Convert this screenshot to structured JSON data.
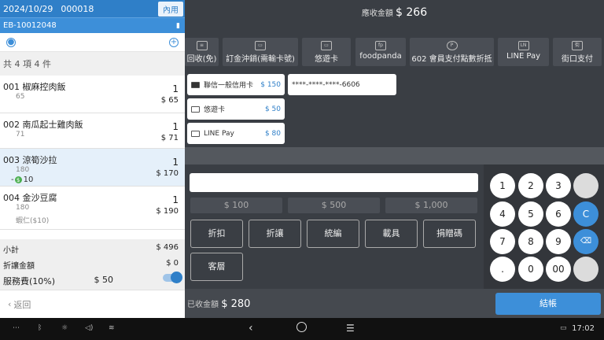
{
  "order": {
    "date": "2024/10/29",
    "number": "000018",
    "dine_type": "內用",
    "id": "EB-10012048",
    "summary": "共 4 項 4 件"
  },
  "items": [
    {
      "name": "001 椒麻控肉飯",
      "price": "65",
      "qty": "1",
      "subtotal": "$ 65"
    },
    {
      "name": "002 南瓜起士雞肉飯",
      "price": "71",
      "qty": "1",
      "subtotal": "$ 71"
    },
    {
      "name": "003 涼筍沙拉",
      "price": "180",
      "qty": "1",
      "subtotal": "$ 170",
      "discount": "10"
    },
    {
      "name": "004 金沙豆腐",
      "price": "180",
      "qty": "1",
      "subtotal": "$ 190",
      "extra": "蝦仁($10)"
    }
  ],
  "totals": {
    "subtotal_label": "小計",
    "subtotal": "$ 496",
    "discount_label": "折讓金額",
    "discount": "$ 0",
    "service_label": "服務費(10%)",
    "service": "$ 50",
    "service_on": true
  },
  "back_label": "返回",
  "due": {
    "label": "應收金額",
    "amount": "$ 266"
  },
  "methods": [
    "回收(免)",
    "訂金沖銷(需輸卡號)",
    "悠遊卡",
    "foodpanda",
    "602 會員支付點數折抵",
    "LINE Pay",
    "街口支付"
  ],
  "method_icons": [
    "receipt-icon",
    "card-icon",
    "card-icon",
    "foodpanda-icon",
    "points-icon",
    "linepay-icon",
    "jkopay-icon"
  ],
  "payments": [
    {
      "label": "聯信一般信用卡",
      "amount": "$ 150"
    },
    {
      "label": "悠遊卡",
      "amount": "$ 50"
    },
    {
      "label": "LINE Pay",
      "amount": "$ 80"
    }
  ],
  "card_number": "****-****-****-6606",
  "quick_amounts": [
    "$ 100",
    "$ 500",
    "$ 1,000"
  ],
  "functions": [
    "折扣",
    "折讓",
    "統編",
    "載具",
    "捐贈碼",
    "客層"
  ],
  "keys": [
    "1",
    "2",
    "3",
    "",
    "4",
    "5",
    "6",
    "C",
    "7",
    "8",
    "9",
    "⌫",
    ".",
    "0",
    "00",
    ""
  ],
  "paid": {
    "label": "已收金額",
    "amount": "$ 280"
  },
  "checkout_label": "結帳",
  "system": {
    "time": "17:02"
  },
  "colors": {
    "accent": "#3d8fd9",
    "header": "#2f7fc8",
    "panel": "#3a3e44"
  }
}
